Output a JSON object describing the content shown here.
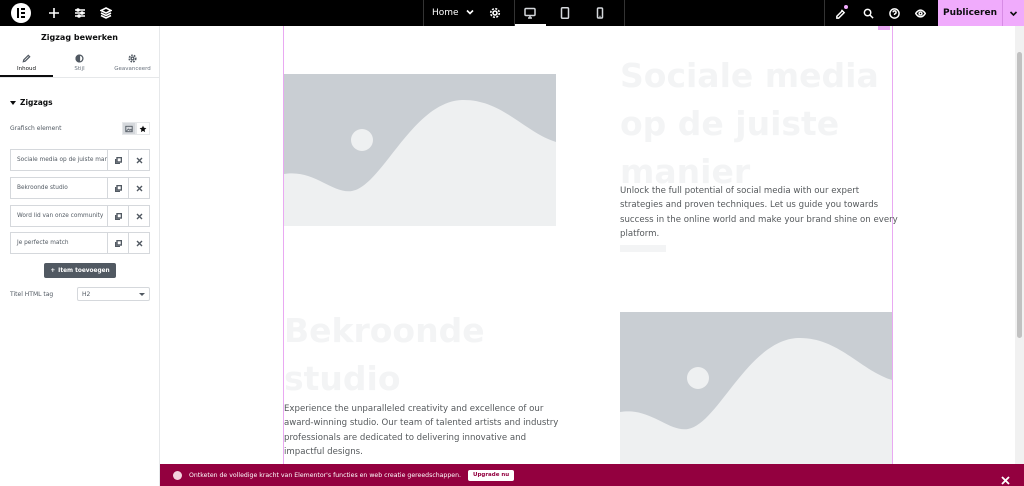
{
  "topbar": {
    "page_name": "Home",
    "publish_label": "Publiceren",
    "icons": [
      "elementor-logo-icon",
      "add-icon",
      "settings-sliders-icon",
      "layers-icon",
      "page-settings-gear-icon",
      "desktop-icon",
      "tablet-icon",
      "mobile-icon",
      "whats-new-icon",
      "search-icon",
      "help-icon",
      "preview-eye-icon",
      "chevron-down-icon"
    ],
    "accent_color": "#f0abfc"
  },
  "panel": {
    "title": "Zigzag bewerken",
    "tabs": [
      {
        "label": "Inhoud"
      },
      {
        "label": "Stijl"
      },
      {
        "label": "Geavanceerd"
      }
    ],
    "section_title": "Zigzags",
    "graphic_label": "Grafisch element",
    "items": [
      {
        "label": "Sociale media op de juiste manier"
      },
      {
        "label": "Bekroonde studio"
      },
      {
        "label": "Word lid van onze community"
      },
      {
        "label": "Je perfecte match"
      }
    ],
    "add_item_label": "Item toevoegen",
    "html_tag_label": "Titel HTML tag",
    "html_tag_value": "H2"
  },
  "canvas": {
    "block1": {
      "title_lines": [
        "Sociale media",
        "op de juiste",
        "manier"
      ],
      "description_lines": [
        "Unlock the full potential of social media with our expert",
        "strategies and proven techniques. Let us guide you towards",
        "success in the online world and make your brand shine on every",
        "platform."
      ]
    },
    "block2": {
      "title_lines": [
        "Bekroonde",
        "studio"
      ],
      "description_lines": [
        "Experience the unparalleled creativity and excellence of our",
        "award-winning studio. Our team of talented artists and industry",
        "professionals are dedicated to delivering innovative and",
        "impactful designs."
      ]
    }
  },
  "banner": {
    "text": "Ontketen de volledige kracht van Elementor's functies en web creatie gereedschappen.",
    "upgrade_label": "Upgrade nu",
    "color": "#93003f"
  }
}
